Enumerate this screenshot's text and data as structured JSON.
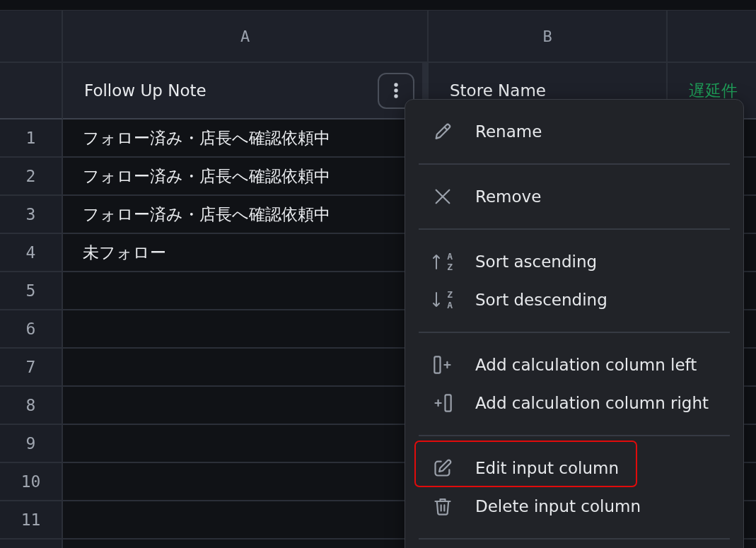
{
  "sheet": {
    "columns": [
      {
        "letter": "A",
        "name": "Follow Up Note",
        "kind": "input",
        "menu_open": true
      },
      {
        "letter": "B",
        "name": "Store Name",
        "kind": "input",
        "menu_open": false
      },
      {
        "name": "遅延件",
        "kind": "calculation",
        "menu_open": false
      }
    ],
    "rows": [
      {
        "number": "1",
        "cells": [
          "フォロー済み・店長へ確認依頼中"
        ]
      },
      {
        "number": "2",
        "cells": [
          "フォロー済み・店長へ確認依頼中"
        ]
      },
      {
        "number": "3",
        "cells": [
          "フォロー済み・店長へ確認依頼中"
        ]
      },
      {
        "number": "4",
        "cells": [
          "未フォロー"
        ]
      },
      {
        "number": "5"
      },
      {
        "number": "6"
      },
      {
        "number": "7"
      },
      {
        "number": "8"
      },
      {
        "number": "9"
      },
      {
        "number": "10"
      },
      {
        "number": "11"
      }
    ]
  },
  "column_menu": {
    "groups": [
      {
        "items": [
          {
            "kind": "rename",
            "label": "Rename",
            "highlighted": false
          }
        ]
      },
      {
        "items": [
          {
            "kind": "remove",
            "label": "Remove",
            "highlighted": false
          }
        ]
      },
      {
        "items": [
          {
            "kind": "ascending",
            "label": "Sort ascending",
            "icon_text": [
              "A",
              "Z"
            ],
            "highlighted": false
          },
          {
            "kind": "descending",
            "label": "Sort descending",
            "icon_text": [
              "Z",
              "A"
            ],
            "highlighted": false
          }
        ]
      },
      {
        "items": [
          {
            "kind": "addleft",
            "label": "Add calculation column left",
            "highlighted": false
          },
          {
            "kind": "addright",
            "label": "Add calculation column right",
            "highlighted": false
          }
        ]
      },
      {
        "items": [
          {
            "kind": "edit",
            "label": "Edit input column",
            "highlighted": true
          },
          {
            "kind": "delete",
            "label": "Delete input column",
            "highlighted": false
          }
        ]
      }
    ]
  }
}
